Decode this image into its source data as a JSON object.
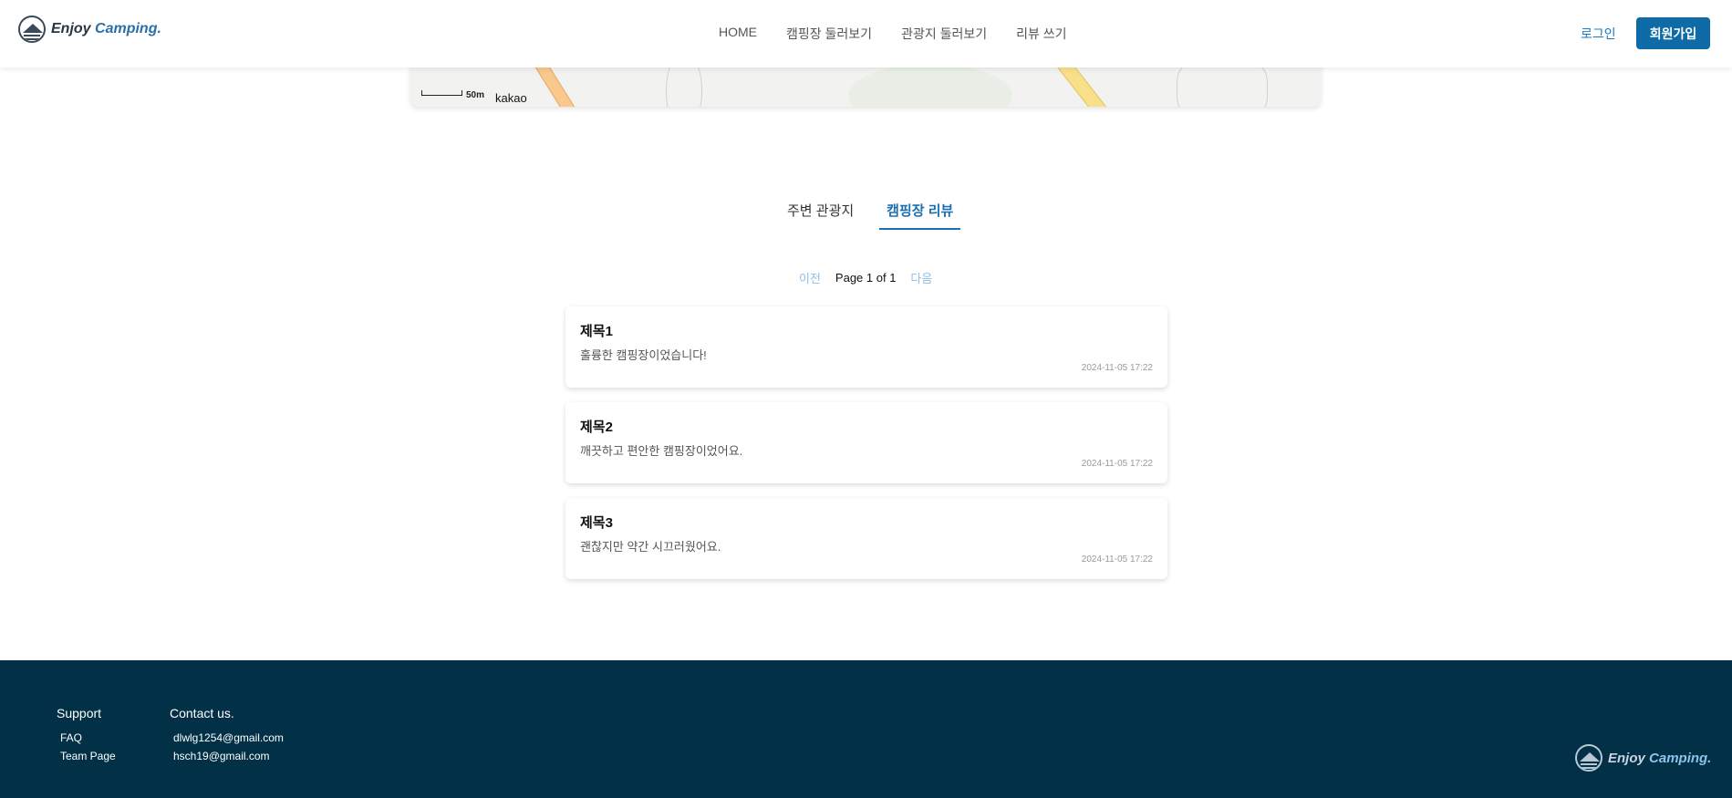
{
  "header": {
    "logo": {
      "brand": "Enjoy",
      "accent": "Camping."
    },
    "nav": [
      {
        "label": "HOME"
      },
      {
        "label": "캠핑장 둘러보기"
      },
      {
        "label": "관광지 둘러보기"
      },
      {
        "label": "리뷰 쓰기"
      }
    ],
    "login_label": "로그인",
    "signup_label": "회원가입"
  },
  "map": {
    "scale_label": "50m",
    "provider": "kakao"
  },
  "tabs": [
    {
      "label": "주변 관광지",
      "active": false
    },
    {
      "label": "캠핑장 리뷰",
      "active": true
    }
  ],
  "pagination": {
    "prev": "이전",
    "info": "Page 1 of 1",
    "next": "다음"
  },
  "reviews": [
    {
      "title": "제목1",
      "content": "훌륭한 캠핑장이었습니다!",
      "date": "2024-11-05 17:22"
    },
    {
      "title": "제목2",
      "content": "깨끗하고 편안한 캠핑장이었어요.",
      "date": "2024-11-05 17:22"
    },
    {
      "title": "제목3",
      "content": "괜찮지만 약간 시끄러웠어요.",
      "date": "2024-11-05 17:22"
    }
  ],
  "footer": {
    "support": {
      "heading": "Support",
      "items": [
        "FAQ",
        "Team Page"
      ]
    },
    "contact": {
      "heading": "Contact us.",
      "items": [
        "dlwlg1254@gmail.com",
        "hsch19@gmail.com"
      ]
    },
    "logo": {
      "brand": "Enjoy",
      "accent": "Camping."
    }
  },
  "colors": {
    "primary": "#0f6aa8",
    "link": "#1a7bc4",
    "footer_bg": "#023047"
  }
}
